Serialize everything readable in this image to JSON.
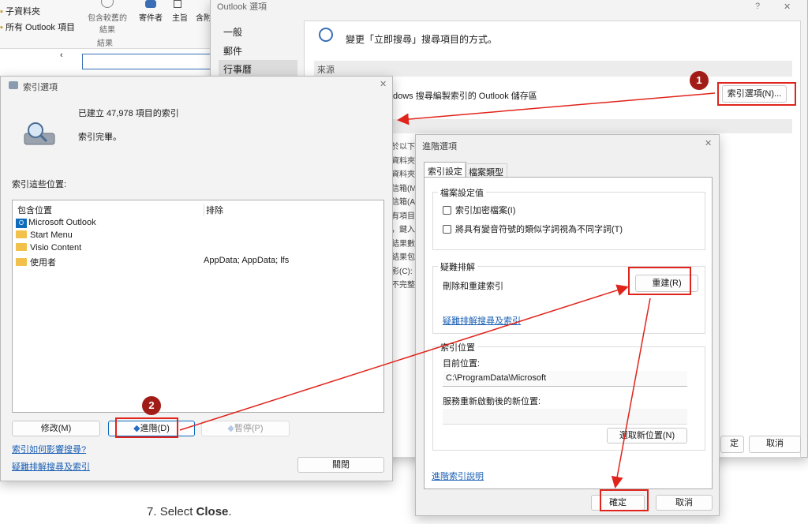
{
  "outlook_nav": {
    "subfolders": "子資料夾",
    "all_items": "所有 Outlook 項目",
    "include_results": "包含較舊的\n結果",
    "results_group": "結果",
    "sender": "寄件者",
    "subject": "主旨",
    "attach": "含附"
  },
  "outlook_options": {
    "title": "Outlook 選項",
    "help": "?",
    "close": "✕",
    "nav": [
      "一般",
      "郵件",
      "行事曆"
    ],
    "heading": "變更「立即搜尋」搜尋項目的方式。",
    "source_label": "來源",
    "source_text": "dows 搜尋編製索引的 Outlook 儲存區",
    "index_options_button": "索引選項(N)...",
    "partial_rows": [
      "於以下",
      "資料夾",
      "資料夾",
      "信箱(M",
      "信箱(A",
      "有項目",
      "，鍵入",
      "結果數",
      "結果包",
      "影(C):",
      "不完整"
    ],
    "ok_partial": "定",
    "cancel": "取消"
  },
  "indexing_options": {
    "title": "索引選項",
    "count_text": "已建立 47,978 項目的索引",
    "status_text": "索引完畢。",
    "locations_label": "索引這些位置:",
    "col_included": "包含位置",
    "col_exclude": "排除",
    "rows": [
      {
        "name": "Microsoft Outlook",
        "exclude": ""
      },
      {
        "name": "Start Menu",
        "exclude": ""
      },
      {
        "name": "Visio Content",
        "exclude": ""
      },
      {
        "name": "使用者",
        "exclude": "AppData; AppData; lfs"
      }
    ],
    "modify_button": "修改(M)",
    "advanced_button": "進階(D)",
    "pause_button": "暫停(P)",
    "link_how": "索引如何影響搜尋?",
    "link_troubleshoot": "疑難排解搜尋及索引",
    "close_button": "關閉"
  },
  "advanced_options": {
    "title": "進階選項",
    "tabs": [
      "索引設定",
      "檔案類型"
    ],
    "file_settings_group": "檔案設定值",
    "encrypt_checkbox": "索引加密檔案(I)",
    "diacritics_checkbox": "將具有變音符號的類似字詞視為不同字詞(T)",
    "troubleshoot_group": "疑難排解",
    "rebuild_label": "刪除和重建索引",
    "rebuild_button": "重建(R)",
    "troubleshoot_link": "疑難排解搜尋及索引",
    "location_group": "索引位置",
    "current_location_label": "目前位置:",
    "current_location_value": "C:\\ProgramData\\Microsoft",
    "new_location_label": "服務重新啟動後的新位置:",
    "new_location_value": "",
    "select_location_button": "選取新位置(N)",
    "help_link": "進階索引說明",
    "ok_button": "確定",
    "cancel_button": "取消"
  },
  "annotations": {
    "badge1": "1",
    "badge2": "2",
    "accent_red": "#e0241b",
    "badge_color": "#a21c17"
  },
  "caption": {
    "number": "7.",
    "pre": "Select ",
    "bold": "Close",
    "post": "."
  }
}
